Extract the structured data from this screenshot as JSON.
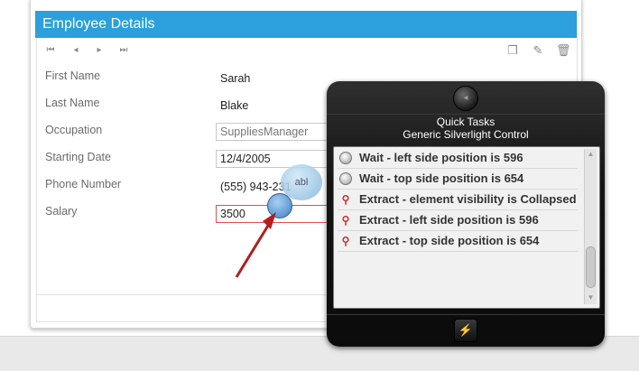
{
  "form": {
    "title": "Employee Details",
    "fields": [
      {
        "label": "First Name",
        "value": "Sarah"
      },
      {
        "label": "Last Name",
        "value": "Blake"
      },
      {
        "label": "Occupation",
        "value": "SuppliesManager"
      },
      {
        "label": "Starting Date",
        "value": "12/4/2005"
      },
      {
        "label": "Phone Number",
        "value": "(555) 943-231"
      },
      {
        "label": "Salary",
        "value": "3500"
      }
    ],
    "nav_icons": [
      "first-icon",
      "previous-icon",
      "next-icon",
      "last-icon"
    ],
    "action_icons": [
      "new-icon",
      "edit-icon",
      "delete-icon"
    ],
    "header_color": "#2ba0dc"
  },
  "overlay": {
    "badge_text": "abl"
  },
  "quick_tasks": {
    "title": "Quick Tasks",
    "subtitle": "Generic Silverlight Control",
    "items": [
      {
        "icon": "wait-icon",
        "text": "Wait - left side position is 596"
      },
      {
        "icon": "wait-icon",
        "text": "Wait - top side position is 654"
      },
      {
        "icon": "extract-icon",
        "text": "Extract - element visibility is Collapsed"
      },
      {
        "icon": "extract-icon",
        "text": "Extract - left side position is 596"
      },
      {
        "icon": "extract-icon",
        "text": "Extract - top side position is 654"
      }
    ]
  }
}
